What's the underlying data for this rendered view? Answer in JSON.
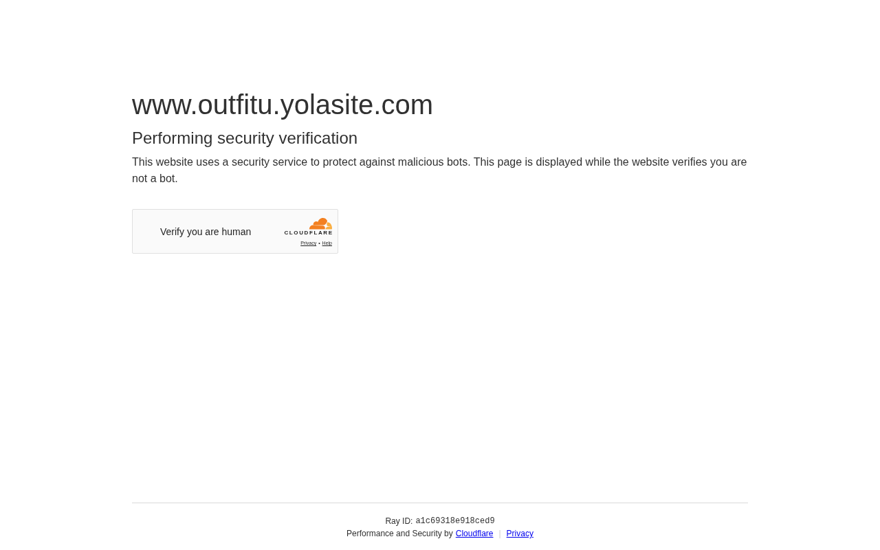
{
  "site_title": "www.outfitu.yolasite.com",
  "heading": "Performing security verification",
  "description": "This website uses a security service to protect against malicious bots. This page is displayed while the website verifies you are not a bot.",
  "challenge_widget": {
    "label": "Verify you are human",
    "brand": "CLOUDFLARE",
    "links": [
      "Privacy",
      "Help"
    ],
    "separator": "•"
  },
  "footer": {
    "ray_id_label": "Ray ID:",
    "ray_id": "a1c69318e918ced9",
    "credit": "Performance and Security by",
    "links": [
      "Cloudflare",
      "Privacy"
    ],
    "separator": "|"
  }
}
